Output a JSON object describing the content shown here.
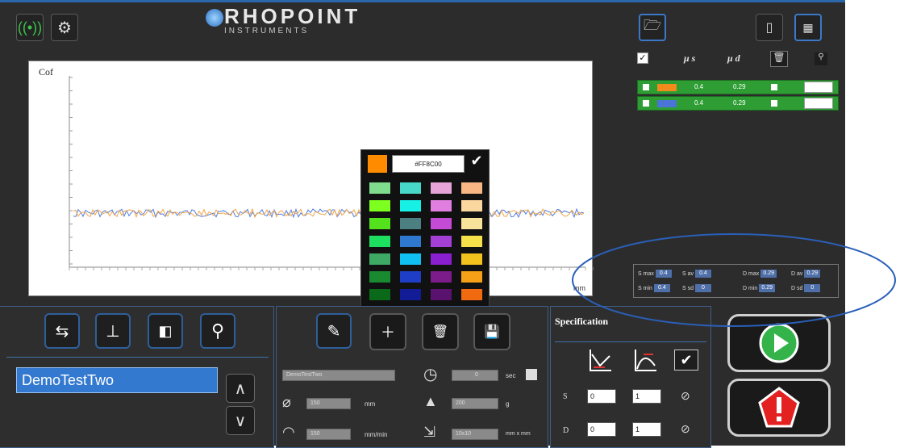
{
  "brand": {
    "name": "RHOPOINT",
    "subtitle": "INSTRUMENTS"
  },
  "top_icons": [
    "antenna-icon",
    "gears-icon",
    "folder-open-icon",
    "phone-dial-icon",
    "keypad-icon"
  ],
  "chart": {
    "ylabel": "Cof",
    "xunit": "mm",
    "chart_data": {
      "type": "line",
      "ylabel": "Cof",
      "xlabel": "mm",
      "series": [
        {
          "color": "#f2a64a"
        },
        {
          "color": "#4f7ee0"
        }
      ]
    }
  },
  "legend": {
    "header_mus": "μ s",
    "header_mud": "μ d",
    "rows": [
      {
        "color": "#f28a1c",
        "mus": "0.4",
        "mud": "0.29"
      },
      {
        "color": "#4a74d6",
        "mus": "0.4",
        "mud": "0.29"
      }
    ]
  },
  "picker": {
    "selected": "#FF8C00",
    "hex": "#FF8C00",
    "colors": [
      [
        "#7fdc8c",
        "#48d8c9",
        "#e5a3d8",
        "#f7b683"
      ],
      [
        "#7dff1f",
        "#17f0e5",
        "#e17fe0",
        "#fbd7a0"
      ],
      [
        "#53e21b",
        "#4b7f81",
        "#c44bd6",
        "#f8e39b"
      ],
      [
        "#1ee060",
        "#2e78d0",
        "#a43fd6",
        "#f5e24a"
      ],
      [
        "#3ea865",
        "#10c0f0",
        "#8a1fd0",
        "#f3c21c"
      ],
      [
        "#1a8a30",
        "#1f3ec8",
        "#7c1b8a",
        "#f6a018"
      ],
      [
        "#0a6a1a",
        "#121c96",
        "#59126e",
        "#f26a10"
      ]
    ]
  },
  "stats": {
    "row1": [
      {
        "label": "S max",
        "val": "0.4"
      },
      {
        "label": "S av",
        "val": "0.4"
      },
      {
        "label": "D max",
        "val": "0.29"
      },
      {
        "label": "D av",
        "val": "0.29"
      }
    ],
    "row2": [
      {
        "label": "S min",
        "val": "0.4"
      },
      {
        "label": "S sd",
        "val": "0"
      },
      {
        "label": "D min",
        "val": "0.29"
      },
      {
        "label": "D sd",
        "val": "0"
      }
    ]
  },
  "test": {
    "name": "DemoTestTwo",
    "field_name": "DemoTestTwo",
    "length": "150",
    "length_unit": "mm",
    "speed": "150",
    "speed_unit": "mm/min",
    "time": "0",
    "time_unit": "sec",
    "load": "200",
    "load_unit": "g",
    "sample": "10x10",
    "sample_unit": "mm x mm"
  },
  "spec": {
    "title": "Specification",
    "s_min": "0",
    "s_max": "1",
    "d_min": "0",
    "d_max": "1",
    "s_label": "S",
    "d_label": "D"
  }
}
